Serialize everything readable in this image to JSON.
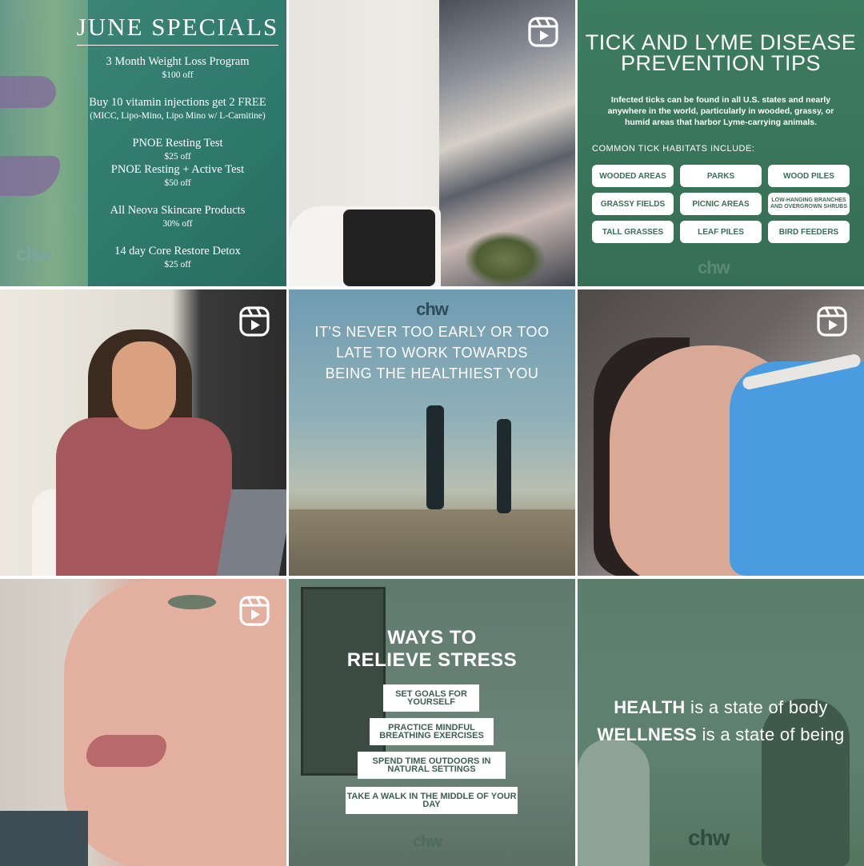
{
  "posts": [
    {
      "type": "image",
      "specials": {
        "title": "JUNE SPECIALS",
        "items": [
          {
            "name": "3 Month Weight Loss Program",
            "detail": "$100 off"
          },
          {
            "name": "Buy 10 vitamin injections get 2 FREE",
            "detail": "(MICC, Lipo-Mino, Lipo Mino w/ L-Carnitine)"
          },
          {
            "name": "PNOE Resting Test",
            "detail": "$25 off"
          },
          {
            "name": "PNOE Resting + Active Test",
            "detail": "$50 off"
          },
          {
            "name": "All Neova Skincare Products",
            "detail": "30% off"
          },
          {
            "name": "14 day Core Restore Detox",
            "detail": "$25 off"
          }
        ],
        "logo": "chw"
      }
    },
    {
      "type": "reel",
      "icon": "reel-icon"
    },
    {
      "type": "image",
      "tick": {
        "title_line1": "TICK AND LYME DISEASE",
        "title_line2": "PREVENTION TIPS",
        "desc": "Infected ticks can be found in all U.S. states and nearly anywhere in the world, particularly in wooded, grassy, or humid areas that harbor Lyme-carrying animals.",
        "habitats_label": "COMMON TICK HABITATS INCLUDE:",
        "habitats": [
          "WOODED AREAS",
          "PARKS",
          "WOOD PILES",
          "GRASSY FIELDS",
          "PICNIC AREAS",
          "LOW-HANGING BRANCHES AND OVERGROWN SHRUBS",
          "TALL GRASSES",
          "LEAF PILES",
          "BIRD FEEDERS"
        ],
        "logo": "chw"
      }
    },
    {
      "type": "reel",
      "icon": "reel-icon"
    },
    {
      "type": "image",
      "quote": {
        "logo": "chw",
        "line1": "IT'S NEVER TOO EARLY OR TOO",
        "line2": "LATE TO WORK TOWARDS",
        "line3": "BEING THE HEALTHIEST YOU"
      }
    },
    {
      "type": "reel",
      "icon": "reel-icon"
    },
    {
      "type": "reel",
      "icon": "reel-icon"
    },
    {
      "type": "image",
      "stress": {
        "title_line1": "WAYS TO",
        "title_line2": "RELIEVE STRESS",
        "tips": [
          "SET GOALS FOR YOURSELF",
          "PRACTICE MINDFUL BREATHING EXERCISES",
          "SPEND TIME OUTDOORS IN NATURAL SETTINGS",
          "TAKE A WALK IN THE MIDDLE OF YOUR DAY"
        ],
        "logo": "chw"
      }
    },
    {
      "type": "image",
      "wellness": {
        "word1": "HEALTH",
        "rest1": " is a state of body",
        "word2": "WELLNESS",
        "rest2": " is a state of being",
        "logo": "chw"
      }
    }
  ],
  "colors": {
    "accent_green": "#3e7c5f",
    "teal": "#2f7a6d",
    "reel_icon": "#ffffff"
  }
}
